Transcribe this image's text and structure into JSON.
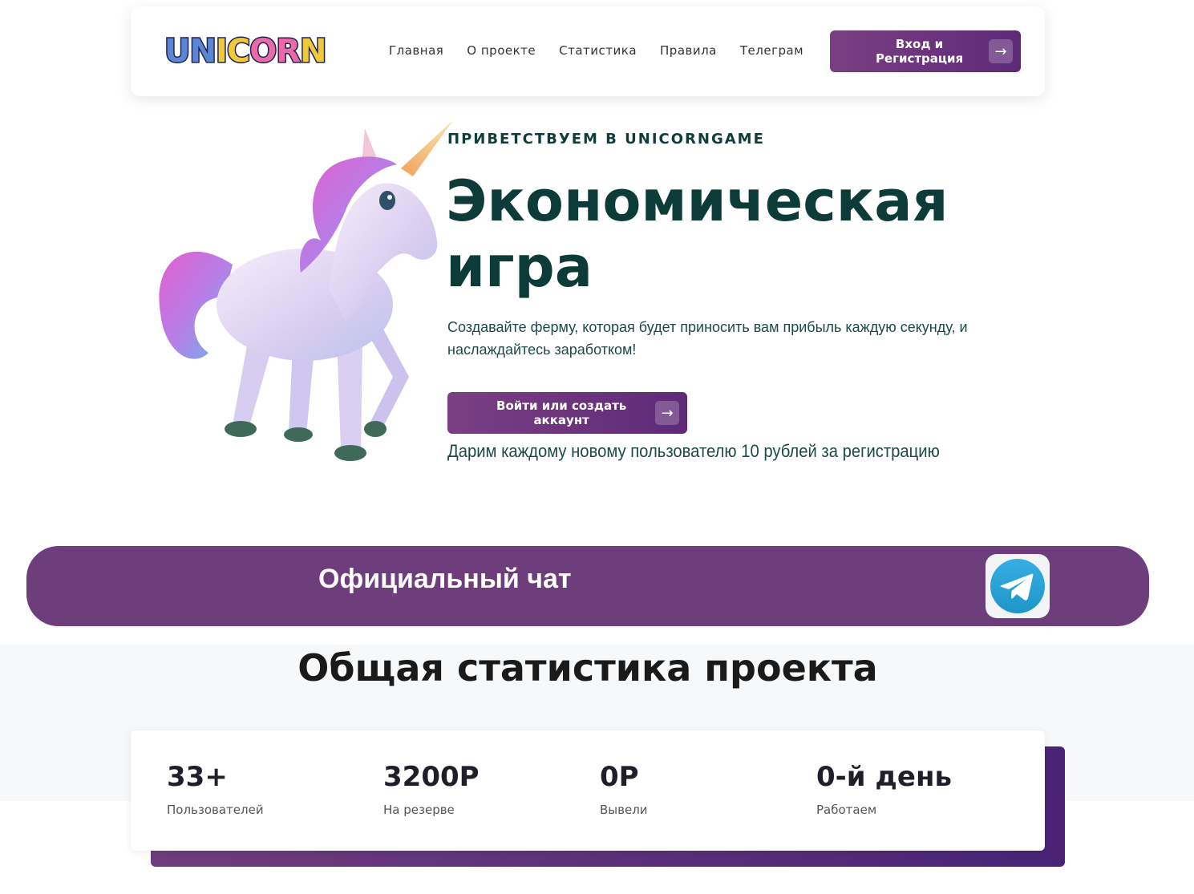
{
  "header": {
    "logo_letters": [
      "U",
      "N",
      "I",
      "C",
      "O",
      "R",
      "N"
    ],
    "logo_colors": [
      "#5b86d6",
      "#5b86d6",
      "#f0c93b",
      "#f0c93b",
      "#e86aa8",
      "#e86aa8",
      "#f0c93b"
    ],
    "nav": [
      "Главная",
      "О проекте",
      "Статистика",
      "Правила",
      "Телеграм"
    ],
    "cta_label": "Вход и Регистрация",
    "cta_icon": "arrow-right-icon"
  },
  "hero": {
    "kicker": "ПРИВЕТСТВУЕМ В UNICORNGAME",
    "title_line1": "Экономическая",
    "title_line2": "игра",
    "description": "Создавайте ферму, которая будет приносить вам прибыль каждую секунду, и наслаждайтесь заработком!",
    "button_label": "Войти или создать аккаунт",
    "gift_text": "Дарим каждому новому пользователю 10 рублей за регистрацию",
    "image": "unicorn-illustration"
  },
  "chat": {
    "title": "Официальный чат",
    "icon": "telegram-icon",
    "banner_color": "#6e3d7b"
  },
  "stats": {
    "title": "Общая статистика проекта",
    "items": [
      {
        "value": "33+",
        "label": "Пользователей"
      },
      {
        "value": "3200Р",
        "label": "На резерве"
      },
      {
        "value": "0Р",
        "label": "Вывели"
      },
      {
        "value": "0-й день",
        "label": "Работаем"
      }
    ]
  },
  "colors": {
    "accent": "#6e3d7b",
    "accent_dark": "#5e2a78",
    "heading": "#0d3b38"
  }
}
